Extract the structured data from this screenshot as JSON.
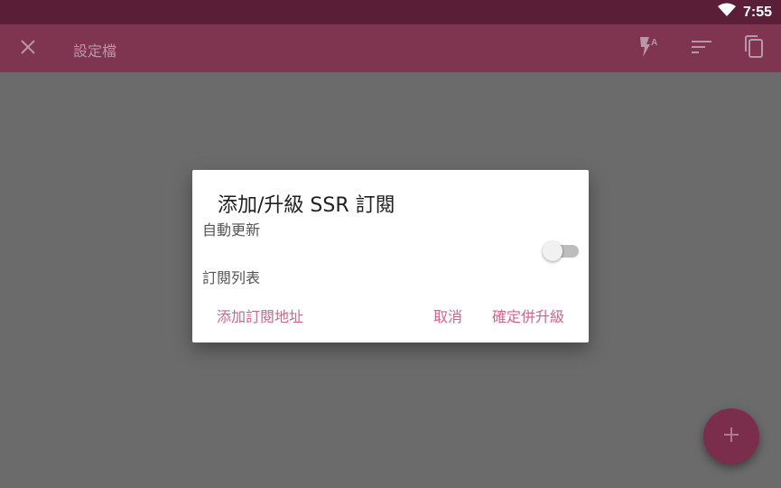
{
  "status_bar": {
    "time": "7:55",
    "icons": [
      "wifi-icon"
    ]
  },
  "app_bar": {
    "title": "設定檔",
    "close_icon": "close-icon",
    "actions": [
      "flash-auto-icon",
      "sort-icon",
      "copy-icon"
    ]
  },
  "dialog": {
    "title": "添加/升級 SSR 訂閱",
    "auto_update_label": "自動更新",
    "auto_update_on": false,
    "subscription_list_label": "訂閱列表",
    "add_button": "添加訂閱地址",
    "cancel_button": "取消",
    "confirm_button": "確定併升級"
  },
  "fab": {
    "icon": "plus-icon"
  },
  "colors": {
    "status_bar": "#5a1f36",
    "app_bar": "#7f3450",
    "accent": "#d2638a",
    "scrim": "#6b6b6b"
  }
}
